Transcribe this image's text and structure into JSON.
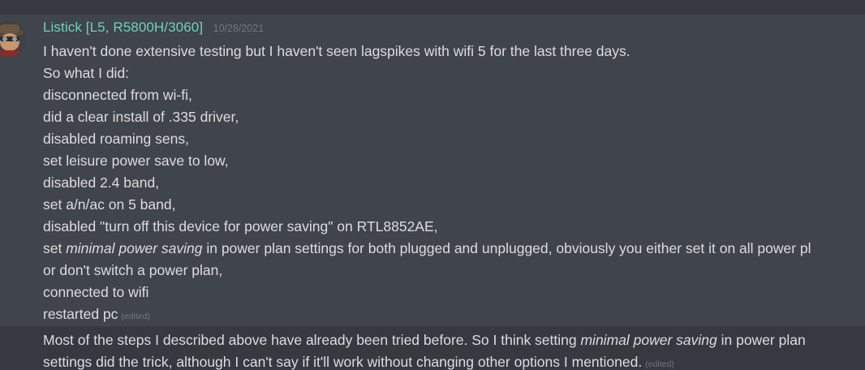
{
  "message": {
    "username": "Listick [L5, R5800H/3060]",
    "timestamp": "10/28/2021",
    "edited_label": "(edited)",
    "lines": [
      "I haven't done extensive testing but I haven't seen lagspikes with wifi 5 for the last three days.",
      "So what I did:",
      "disconnected from wi-fi,",
      "did a clear install of .335 driver,",
      "disabled roaming sens,",
      "set leisure power save to low,",
      "disabled 2.4 band,",
      "set a/n/ac on 5 band,",
      "disabled \"turn off this device for power saving\" on RTL8852AE,"
    ],
    "line_power_plan": {
      "before": "set ",
      "em": "minimal power saving",
      "after": " in power plan settings for both plugged and unplugged, obviously you either set it on all power pl"
    },
    "tail_lines": [
      "or don't switch a power plan,",
      "connected to wifi"
    ],
    "last_line": "restarted pc"
  },
  "followup": {
    "line1": {
      "before": "Most of the steps I described above have already been tried before. So I think setting ",
      "em": "minimal power saving",
      "after": " in power plan"
    },
    "line2": "settings did the trick, although I can't say if it'll work without changing other options I mentioned.",
    "edited_label": "(edited)"
  },
  "icons": {
    "avatar": "user-avatar-icon"
  },
  "colors": {
    "background": "#36393f",
    "hover_background": "#40444b",
    "username": "#6fd3b8",
    "text": "#dcddde",
    "muted": "#72767d"
  }
}
